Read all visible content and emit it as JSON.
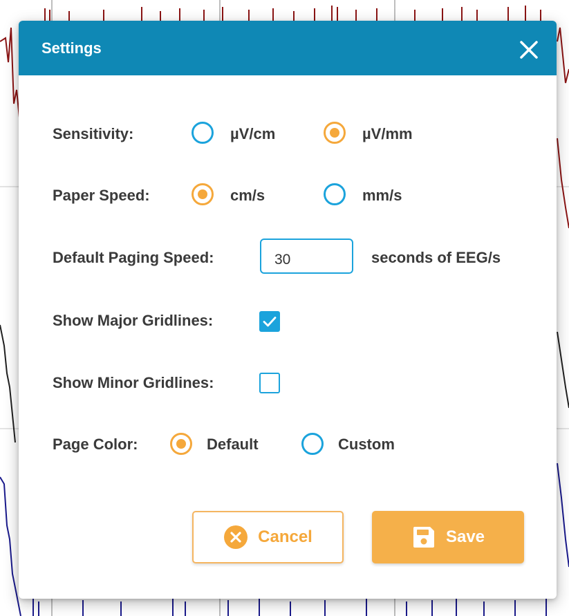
{
  "dialog": {
    "title": "Settings",
    "header_color": "#0f88b5"
  },
  "sensitivity": {
    "label": "Sensitivity:",
    "options": [
      "µV/cm",
      "µV/mm"
    ],
    "selected": "µV/mm"
  },
  "paper_speed": {
    "label": "Paper Speed:",
    "options": [
      "cm/s",
      "mm/s"
    ],
    "selected": "cm/s"
  },
  "paging_speed": {
    "label": "Default Paging Speed:",
    "value": "30",
    "unit": "seconds of EEG/s"
  },
  "major_gridlines": {
    "label": "Show Major Gridlines:",
    "checked": true
  },
  "minor_gridlines": {
    "label": "Show Minor Gridlines:",
    "checked": false
  },
  "page_color": {
    "label": "Page Color:",
    "options": [
      "Default",
      "Custom"
    ],
    "selected": "Default"
  },
  "buttons": {
    "cancel": "Cancel",
    "save": "Save"
  },
  "icons": {
    "close": "close-icon",
    "cancel": "cancel-circle-icon",
    "save": "floppy-disk-icon"
  },
  "colors": {
    "accent_blue": "#1ba3dc",
    "accent_orange": "#f5a83b",
    "text": "#3a3a3a"
  }
}
